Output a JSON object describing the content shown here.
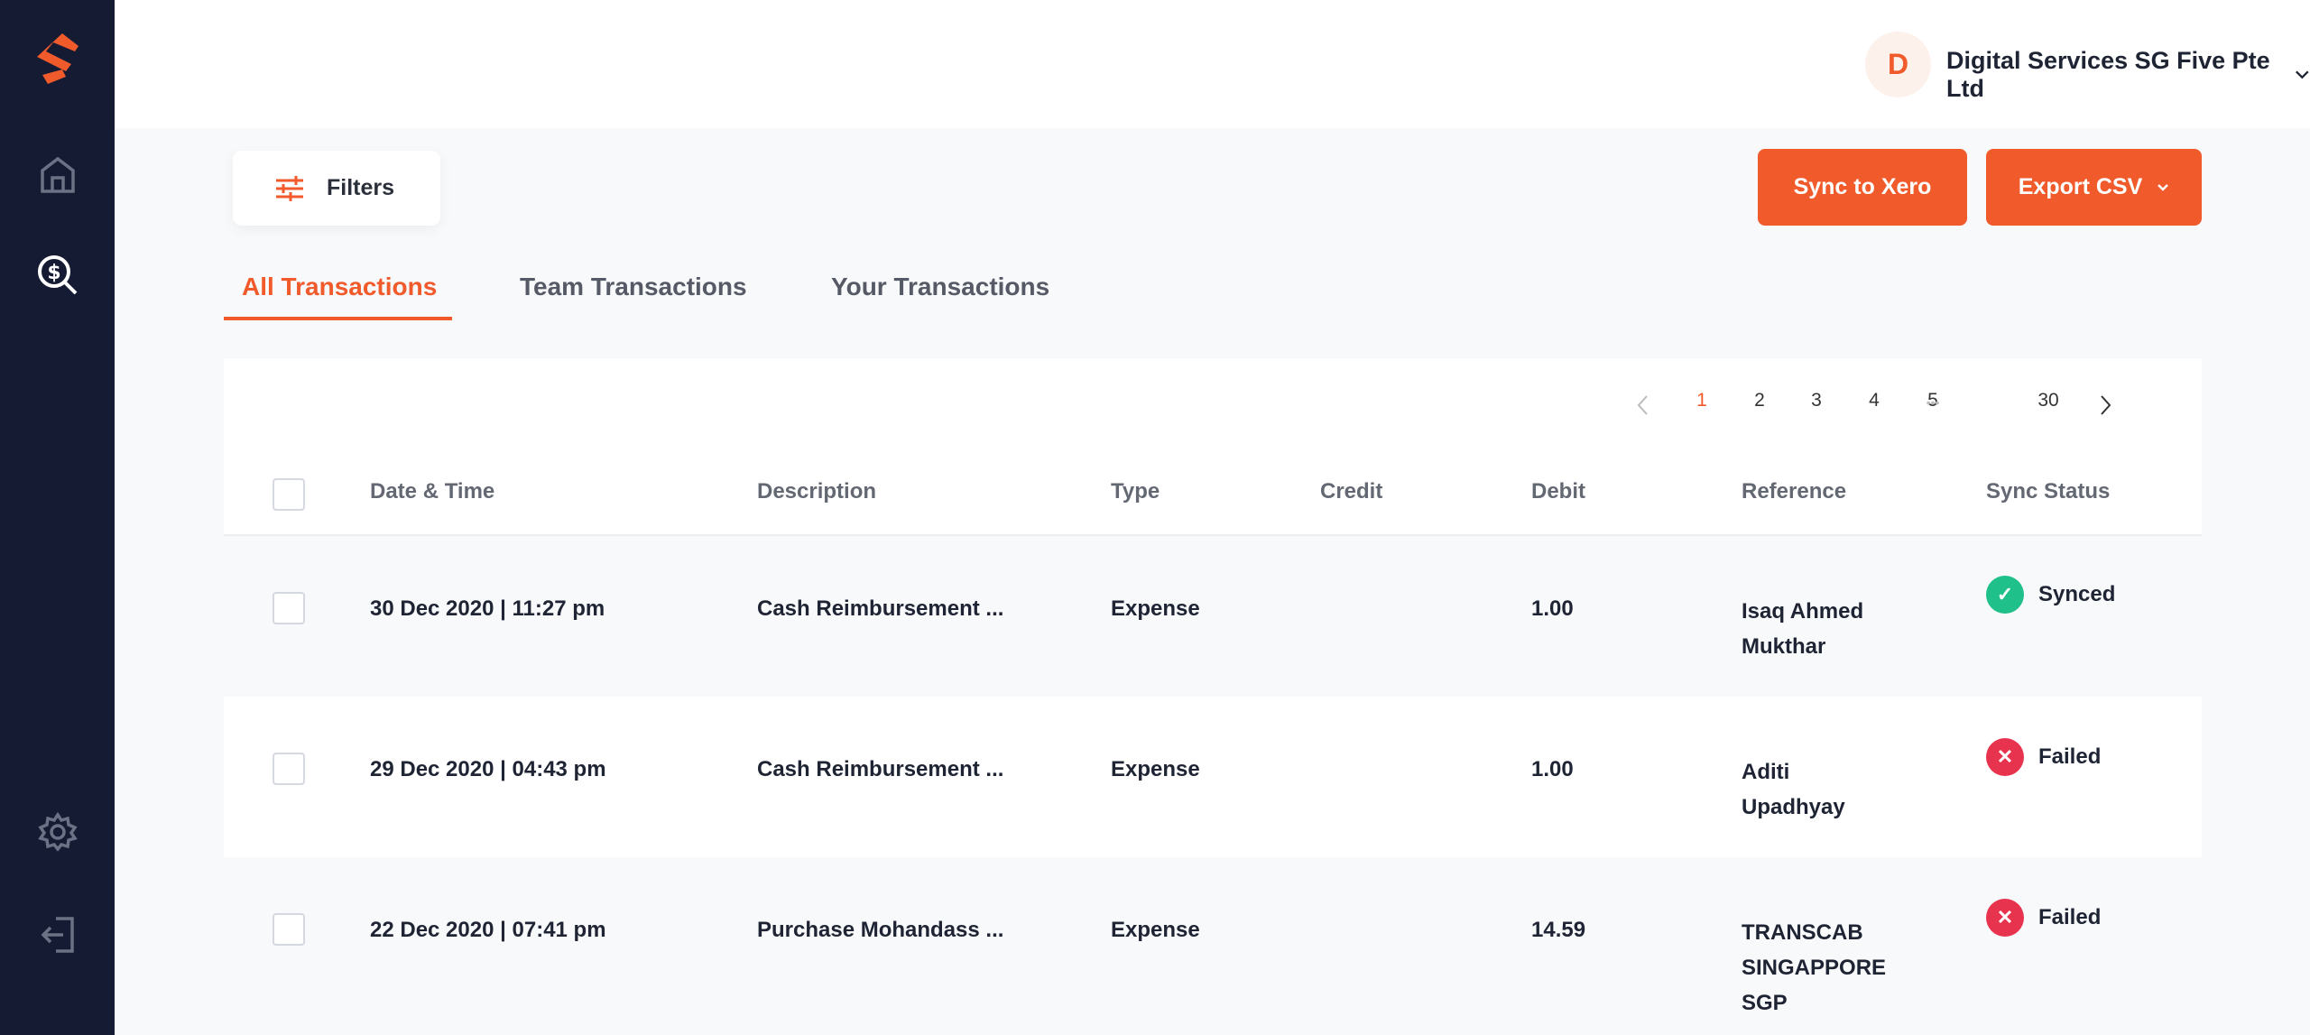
{
  "header": {
    "avatar_initial": "D",
    "company": "Digital Services SG Five Pte Ltd"
  },
  "toolbar": {
    "filters": "Filters",
    "sync": "Sync to Xero",
    "export": "Export CSV"
  },
  "tabs": [
    "All Transactions",
    "Team Transactions",
    "Your Transactions"
  ],
  "pagination": {
    "pages": [
      "1",
      "2",
      "3",
      "4",
      "5",
      "30"
    ],
    "current": "1",
    "ellipsis": "•••"
  },
  "columns": [
    "Date & Time",
    "Description",
    "Type",
    "Credit",
    "Debit",
    "Reference",
    "Sync Status"
  ],
  "rows": [
    {
      "date": "30 Dec 2020 | 11:27 pm",
      "description": "Cash Reimbursement ...",
      "type": "Expense",
      "credit": "",
      "debit": "1.00",
      "reference": [
        "Isaq Ahmed",
        "Mukthar"
      ],
      "status": "Synced"
    },
    {
      "date": "29 Dec 2020 | 04:43 pm",
      "description": "Cash Reimbursement ...",
      "type": "Expense",
      "credit": "",
      "debit": "1.00",
      "reference": [
        "Aditi",
        "Upadhyay"
      ],
      "status": "Failed"
    },
    {
      "date": "22 Dec 2020 | 07:41 pm",
      "description": "Purchase Mohandass ...",
      "type": "Expense",
      "credit": "",
      "debit": "14.59",
      "reference": [
        "TRANSCAB",
        "SINGAPPORE",
        "SGP"
      ],
      "status": "Failed"
    }
  ],
  "colors": {
    "accent": "#f15a2b",
    "sidebar": "#141b33",
    "synced": "#1fc08a",
    "failed": "#e8334f"
  }
}
